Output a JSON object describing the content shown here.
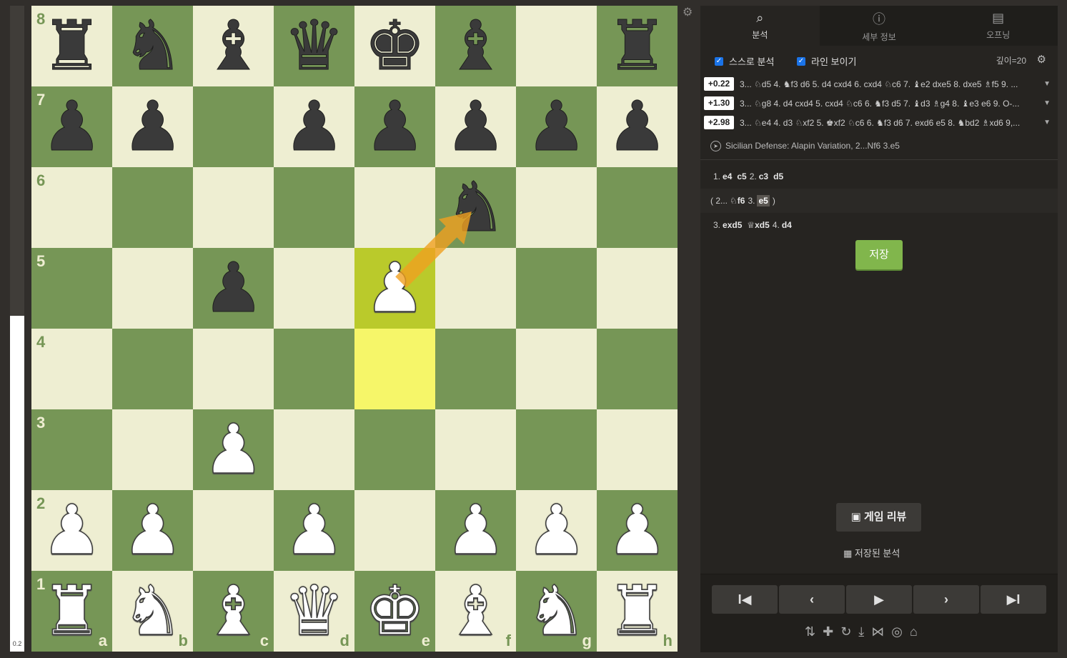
{
  "eval": {
    "label": "0.2",
    "white_fraction": 0.52
  },
  "board": {
    "files": [
      "a",
      "b",
      "c",
      "d",
      "e",
      "f",
      "g",
      "h"
    ],
    "ranks": [
      "8",
      "7",
      "6",
      "5",
      "4",
      "3",
      "2",
      "1"
    ],
    "pieces": {
      "a8": "bR",
      "b8": "bN",
      "c8": "bB",
      "d8": "bQ",
      "e8": "bK",
      "f8": "bB",
      "h8": "bR",
      "a7": "bP",
      "b7": "bP",
      "d7": "bP",
      "e7": "bP",
      "f7": "bP",
      "g7": "bP",
      "h7": "bP",
      "f6": "bN",
      "c5": "bP",
      "e5": "wP",
      "c3": "wP",
      "a2": "wP",
      "b2": "wP",
      "d2": "wP",
      "f2": "wP",
      "g2": "wP",
      "h2": "wP",
      "a1": "wR",
      "b1": "wN",
      "c1": "wB",
      "d1": "wQ",
      "e1": "wK",
      "f1": "wB",
      "g1": "wN",
      "h1": "wR"
    },
    "highlight": [
      "e5",
      "e4"
    ],
    "arrow": {
      "from": "e5",
      "to": "f6",
      "color": "#f0a020"
    }
  },
  "panel": {
    "tabs": [
      {
        "label": "분석",
        "icon": "magnifier-icon",
        "active": true
      },
      {
        "label": "세부 정보",
        "icon": "info-icon",
        "active": false
      },
      {
        "label": "오프닝",
        "icon": "book-icon",
        "active": false
      }
    ],
    "options": {
      "self_analysis": "스스로 분석",
      "show_lines": "라인 보이기",
      "depth": "깊이=20"
    },
    "lines": [
      {
        "score": "+0.22",
        "pv": "3... ♘d5 4. ♞f3 d6 5. d4 cxd4 6. cxd4 ♘c6 7. ♝e2 dxe5 8. dxe5 ♗f5 9. ..."
      },
      {
        "score": "+1.30",
        "pv": "3... ♘g8 4. d4 cxd4 5. cxd4 ♘c6 6. ♞f3 d5 7. ♝d3 ♗g4 8. ♝e3 e6 9. O-..."
      },
      {
        "score": "+2.98",
        "pv": "3... ♘e4 4. d3 ♘xf2 5. ♚xf2 ♘c6 6. ♞f3 d6 7. exd6 e5 8. ♞bd2 ♗xd6 9,..."
      }
    ],
    "opening": "Sicilian Defense: Alapin Variation, 2...Nf6 3.e5",
    "moves": {
      "row1_n1": "1.",
      "row1_m1": "e4",
      "row1_m2": "c5",
      "row1_n2": "2.",
      "row1_m3": "c3",
      "row1_m4": "d5",
      "var_open": "( 2...",
      "var_m1": "♘f6",
      "var_n2": "3.",
      "var_m2": "e5",
      "var_close": ")",
      "row3_n1": "3.",
      "row3_m1": "exd5",
      "row3_m2": "♕xd5",
      "row3_n2": "4.",
      "row3_m3": "d4"
    },
    "save_label": "저장",
    "review_label": "게임 리뷰",
    "saved_label": "저장된 분석",
    "nav": {
      "first": "I◀",
      "prev": "‹",
      "play": "▶",
      "next": "›",
      "last": "▶I"
    },
    "tools": [
      "flip-icon",
      "add-icon",
      "reset-icon",
      "download-icon",
      "share-icon",
      "target-icon",
      "explorer-icon"
    ]
  }
}
